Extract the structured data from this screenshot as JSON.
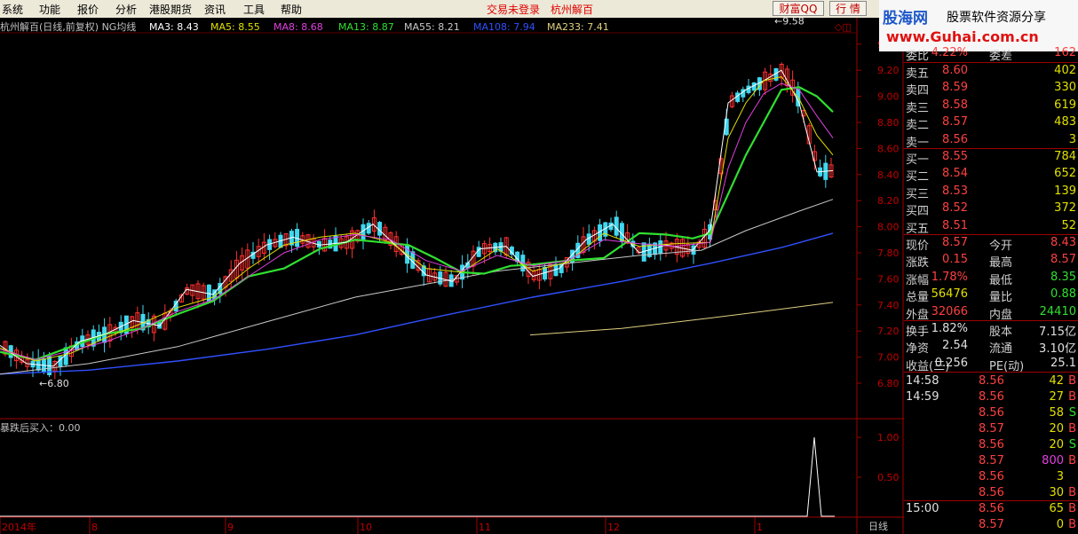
{
  "menu": [
    "系统",
    "功能",
    "报价",
    "分析",
    "港股期货",
    "资讯",
    "工具",
    "帮助"
  ],
  "top_status": {
    "trade": "交易未登录",
    "stock_name": "杭州解百"
  },
  "top_buttons": {
    "caifu": "财富QQ",
    "quote": "行 情"
  },
  "logo": {
    "brand": "股海网",
    "slogan": "股票软件资源分享",
    "url": "www.Guhai.com.cn"
  },
  "chart_header": {
    "title": "杭州解百(日线,前复权) NG均线",
    "ma": [
      {
        "label": "MA3: 8.43",
        "color": "#ffffff"
      },
      {
        "label": "MA5: 8.55",
        "color": "#e0e000"
      },
      {
        "label": "MA8: 8.68",
        "color": "#e040e0"
      },
      {
        "label": "MA13: 8.87",
        "color": "#30e030"
      },
      {
        "label": "MA55: 8.21",
        "color": "#c8c8c8"
      },
      {
        "label": "MA108: 7.94",
        "color": "#3050ff"
      },
      {
        "label": "MA233: 7.41",
        "color": "#e0d080"
      }
    ]
  },
  "indicator": {
    "label": "暴跌后买入：0.00"
  },
  "period_label": "日线",
  "chart_data": {
    "type": "candlestick",
    "y_ticks": [
      "9.40",
      "9.20",
      "9.00",
      "8.80",
      "8.60",
      "8.40",
      "8.20",
      "8.00",
      "7.80",
      "7.60",
      "7.40",
      "7.20",
      "7.00",
      "6.80"
    ],
    "ylim": [
      6.75,
      9.65
    ],
    "x_ticks": [
      "2014年",
      "8",
      "9",
      "10",
      "11",
      "12",
      "1"
    ],
    "annotations": {
      "high": "9.58",
      "low": "6.80"
    },
    "indicator_ticks": [
      "1.00",
      "0.50"
    ],
    "ma_lines": {
      "MA233": [
        [
          597,
          7.17
        ],
        [
          700,
          7.22
        ],
        [
          800,
          7.3
        ],
        [
          870,
          7.36
        ],
        [
          938,
          7.42
        ]
      ],
      "MA108": [
        [
          0,
          6.87
        ],
        [
          100,
          6.9
        ],
        [
          200,
          6.97
        ],
        [
          300,
          7.06
        ],
        [
          400,
          7.17
        ],
        [
          500,
          7.32
        ],
        [
          600,
          7.46
        ],
        [
          700,
          7.58
        ],
        [
          800,
          7.72
        ],
        [
          880,
          7.84
        ],
        [
          938,
          7.95
        ]
      ],
      "MA55": [
        [
          0,
          6.87
        ],
        [
          100,
          6.95
        ],
        [
          200,
          7.08
        ],
        [
          300,
          7.27
        ],
        [
          400,
          7.46
        ],
        [
          480,
          7.56
        ],
        [
          560,
          7.66
        ],
        [
          640,
          7.72
        ],
        [
          720,
          7.78
        ],
        [
          790,
          7.82
        ],
        [
          840,
          7.97
        ],
        [
          900,
          8.12
        ],
        [
          938,
          8.21
        ]
      ],
      "MA13": [
        [
          0,
          7.04
        ],
        [
          40,
          6.98
        ],
        [
          80,
          7.08
        ],
        [
          120,
          7.18
        ],
        [
          160,
          7.22
        ],
        [
          200,
          7.33
        ],
        [
          240,
          7.43
        ],
        [
          280,
          7.62
        ],
        [
          320,
          7.68
        ],
        [
          360,
          7.83
        ],
        [
          400,
          7.9
        ],
        [
          430,
          7.88
        ],
        [
          460,
          7.86
        ],
        [
          490,
          7.76
        ],
        [
          520,
          7.65
        ],
        [
          545,
          7.64
        ],
        [
          575,
          7.7
        ],
        [
          600,
          7.71
        ],
        [
          640,
          7.74
        ],
        [
          680,
          7.76
        ],
        [
          720,
          7.95
        ],
        [
          750,
          7.94
        ],
        [
          780,
          7.91
        ],
        [
          800,
          7.95
        ],
        [
          820,
          8.25
        ],
        [
          840,
          8.55
        ],
        [
          860,
          8.8
        ],
        [
          880,
          9.05
        ],
        [
          900,
          9.07
        ],
        [
          920,
          9.0
        ],
        [
          938,
          8.88
        ]
      ],
      "MA3": [
        [
          0,
          7.09
        ],
        [
          30,
          6.95
        ],
        [
          60,
          6.93
        ],
        [
          90,
          7.12
        ],
        [
          120,
          7.18
        ],
        [
          150,
          7.28
        ],
        [
          180,
          7.24
        ],
        [
          210,
          7.52
        ],
        [
          240,
          7.48
        ],
        [
          270,
          7.72
        ],
        [
          300,
          7.86
        ],
        [
          330,
          7.92
        ],
        [
          360,
          7.86
        ],
        [
          390,
          7.88
        ],
        [
          420,
          8.02
        ],
        [
          450,
          7.83
        ],
        [
          480,
          7.63
        ],
        [
          510,
          7.58
        ],
        [
          540,
          7.83
        ],
        [
          570,
          7.85
        ],
        [
          600,
          7.62
        ],
        [
          630,
          7.68
        ],
        [
          660,
          7.9
        ],
        [
          690,
          8.02
        ],
        [
          720,
          7.8
        ],
        [
          750,
          7.86
        ],
        [
          780,
          7.82
        ],
        [
          800,
          7.98
        ],
        [
          820,
          8.95
        ],
        [
          840,
          9.05
        ],
        [
          860,
          9.12
        ],
        [
          880,
          9.2
        ],
        [
          900,
          8.95
        ],
        [
          920,
          8.42
        ],
        [
          938,
          8.43
        ]
      ],
      "MA5": [
        [
          0,
          7.07
        ],
        [
          40,
          6.97
        ],
        [
          80,
          7.03
        ],
        [
          120,
          7.15
        ],
        [
          160,
          7.26
        ],
        [
          200,
          7.38
        ],
        [
          240,
          7.46
        ],
        [
          280,
          7.68
        ],
        [
          320,
          7.86
        ],
        [
          360,
          7.92
        ],
        [
          400,
          7.95
        ],
        [
          440,
          7.88
        ],
        [
          480,
          7.68
        ],
        [
          520,
          7.65
        ],
        [
          560,
          7.83
        ],
        [
          600,
          7.66
        ],
        [
          640,
          7.73
        ],
        [
          680,
          7.95
        ],
        [
          720,
          7.85
        ],
        [
          760,
          7.87
        ],
        [
          800,
          7.88
        ],
        [
          820,
          8.68
        ],
        [
          840,
          8.95
        ],
        [
          860,
          9.12
        ],
        [
          880,
          9.15
        ],
        [
          900,
          8.98
        ],
        [
          920,
          8.7
        ],
        [
          938,
          8.55
        ]
      ],
      "MA8": [
        [
          0,
          7.06
        ],
        [
          40,
          6.98
        ],
        [
          80,
          7.05
        ],
        [
          120,
          7.12
        ],
        [
          160,
          7.22
        ],
        [
          200,
          7.35
        ],
        [
          240,
          7.44
        ],
        [
          280,
          7.62
        ],
        [
          320,
          7.8
        ],
        [
          360,
          7.9
        ],
        [
          400,
          7.94
        ],
        [
          440,
          7.9
        ],
        [
          480,
          7.74
        ],
        [
          520,
          7.66
        ],
        [
          560,
          7.78
        ],
        [
          600,
          7.7
        ],
        [
          640,
          7.74
        ],
        [
          680,
          7.9
        ],
        [
          720,
          7.87
        ],
        [
          760,
          7.85
        ],
        [
          800,
          7.88
        ],
        [
          820,
          8.45
        ],
        [
          840,
          8.8
        ],
        [
          860,
          9.02
        ],
        [
          880,
          9.1
        ],
        [
          900,
          9.05
        ],
        [
          920,
          8.85
        ],
        [
          938,
          8.68
        ]
      ]
    }
  },
  "quote_panel": {
    "weibi": {
      "label": "委比",
      "value": "4.22%",
      "label2": "委差",
      "value2": "162"
    },
    "sell": [
      {
        "label": "卖五",
        "price": "8.60",
        "vol": "402"
      },
      {
        "label": "卖四",
        "price": "8.59",
        "vol": "330"
      },
      {
        "label": "卖三",
        "price": "8.58",
        "vol": "619"
      },
      {
        "label": "卖二",
        "price": "8.57",
        "vol": "483"
      },
      {
        "label": "卖一",
        "price": "8.56",
        "vol": "3"
      }
    ],
    "buy": [
      {
        "label": "买一",
        "price": "8.55",
        "vol": "784"
      },
      {
        "label": "买二",
        "price": "8.54",
        "vol": "652"
      },
      {
        "label": "买三",
        "price": "8.53",
        "vol": "139"
      },
      {
        "label": "买四",
        "price": "8.52",
        "vol": "372"
      },
      {
        "label": "买五",
        "price": "8.51",
        "vol": "52"
      }
    ],
    "stats1": [
      {
        "l1": "现价",
        "v1": "8.57",
        "l2": "今开",
        "v2": "8.43",
        "c1": "#ff4040",
        "c2": "#ff4040"
      },
      {
        "l1": "涨跌",
        "v1": "0.15",
        "l2": "最高",
        "v2": "8.57",
        "c1": "#ff4040",
        "c2": "#ff4040"
      },
      {
        "l1": "涨幅",
        "v1": "1.78%",
        "l2": "最低",
        "v2": "8.35",
        "c1": "#ff4040",
        "c2": "#30e030"
      },
      {
        "l1": "总量",
        "v1": "56476",
        "l2": "量比",
        "v2": "0.88",
        "c1": "#e0e000",
        "c2": "#30e030"
      },
      {
        "l1": "外盘",
        "v1": "32066",
        "l2": "内盘",
        "v2": "24410",
        "c1": "#ff4040",
        "c2": "#30e030"
      }
    ],
    "stats2": [
      {
        "l1": "换手",
        "v1": "1.82%",
        "l2": "股本",
        "v2": "7.15亿"
      },
      {
        "l1": "净资",
        "v1": "2.54",
        "l2": "流通",
        "v2": "3.10亿"
      },
      {
        "l1": "收益(三)",
        "v1": "0.256",
        "l2": "PE(动)",
        "v2": "25.1"
      }
    ]
  },
  "ticks": [
    {
      "time": "14:58",
      "price": "8.56",
      "vol": "42",
      "bs": "B"
    },
    {
      "time": "14:59",
      "price": "8.56",
      "vol": "27",
      "bs": "B"
    },
    {
      "time": "",
      "price": "8.56",
      "vol": "58",
      "bs": "S"
    },
    {
      "time": "",
      "price": "8.57",
      "vol": "20",
      "bs": "B"
    },
    {
      "time": "",
      "price": "8.56",
      "vol": "20",
      "bs": "S"
    },
    {
      "time": "",
      "price": "8.57",
      "vol": "800",
      "bs": "B"
    },
    {
      "time": "",
      "price": "8.56",
      "vol": "3",
      "bs": ""
    },
    {
      "time": "",
      "price": "8.56",
      "vol": "30",
      "bs": "B"
    },
    {
      "time": "15:00",
      "price": "8.56",
      "vol": "65",
      "bs": "B"
    },
    {
      "time": "",
      "price": "8.57",
      "vol": "0",
      "bs": "B"
    }
  ]
}
